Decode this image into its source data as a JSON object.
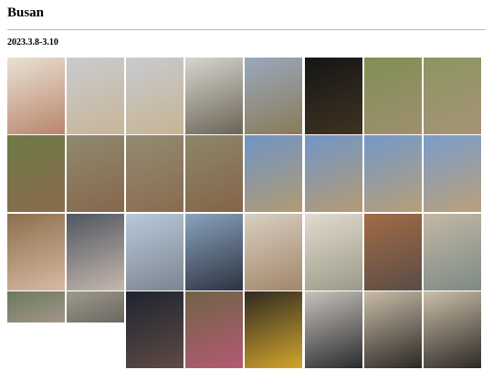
{
  "page": {
    "title": "Busan",
    "date_range": "2023.3.8-3.10"
  },
  "photos": [
    {
      "label": "breakfast-plate",
      "c1": "#e9e2d6",
      "c2": "#b9856a"
    },
    {
      "label": "beach-person",
      "c1": "#c9ccd0",
      "c2": "#c8b497"
    },
    {
      "label": "beach-person-2",
      "c1": "#c7cbd0",
      "c2": "#c7b393"
    },
    {
      "label": "stone-monument",
      "c1": "#d6d6d0",
      "c2": "#6b6454"
    },
    {
      "label": "hill-pavilion",
      "c1": "#9aa9bd",
      "c2": "#8a7a58"
    },
    {
      "label": "night-shrine",
      "c1": "#151515",
      "c2": "#3f3320"
    },
    {
      "label": "bamboo-woman",
      "c1": "#7f8f53",
      "c2": "#a08f70"
    },
    {
      "label": "forest-woman",
      "c1": "#8d9560",
      "c2": "#a69477"
    },
    {
      "label": "tree-woman",
      "c1": "#6d7a46",
      "c2": "#8b6b4c"
    },
    {
      "label": "bare-forest",
      "c1": "#8f8a6f",
      "c2": "#86674c"
    },
    {
      "label": "bare-forest-2",
      "c1": "#928c72",
      "c2": "#8a6b4f"
    },
    {
      "label": "bare-forest-3",
      "c1": "#8d876b",
      "c2": "#846448"
    },
    {
      "label": "village-field",
      "c1": "#6f95c6",
      "c2": "#b29a72"
    },
    {
      "label": "village-field-2",
      "c1": "#7096c8",
      "c2": "#b59b73"
    },
    {
      "label": "village-field-3",
      "c1": "#7399cb",
      "c2": "#b79e76"
    },
    {
      "label": "village-field-4",
      "c1": "#7a9dcb",
      "c2": "#b9a07a"
    },
    {
      "label": "hillside-selfie",
      "c1": "#8c6f4d",
      "c2": "#d8b9a3"
    },
    {
      "label": "couple-masks",
      "c1": "#4f5661",
      "c2": "#c6b7ad"
    },
    {
      "label": "station-building",
      "c1": "#b9c9db",
      "c2": "#7c8590"
    },
    {
      "label": "station-selfie",
      "c1": "#8aa3bd",
      "c2": "#2c3340"
    },
    {
      "label": "pancake-dish",
      "c1": "#d8cfc2",
      "c2": "#a2866a"
    },
    {
      "label": "side-dishes",
      "c1": "#e2dbd0",
      "c2": "#9b9a86"
    },
    {
      "label": "restaurant-man",
      "c1": "#a26c45",
      "c2": "#5a4c46"
    },
    {
      "label": "restaurant-table",
      "c1": "#c2b8a6",
      "c2": "#7e8a84"
    },
    {
      "label": "alley-couple",
      "c1": "#6a7a5c",
      "c2": "#a3958a"
    },
    {
      "label": "mirror-selfie",
      "c1": "#9c9a8c",
      "c2": "#6c6660"
    },
    {
      "label": "couple-portrait",
      "c1": "#1f2430",
      "c2": "#5e4a44"
    },
    {
      "label": "flower-garden",
      "c1": "#6f6346",
      "c2": "#b45a72"
    },
    {
      "label": "dinner-food",
      "c1": "#2f2a22",
      "c2": "#d2a52c"
    },
    {
      "label": "couple-close",
      "c1": "#c7c2bc",
      "c2": "#2b2b2e"
    },
    {
      "label": "elevator-couple",
      "c1": "#c9bda8",
      "c2": "#2b2724"
    },
    {
      "label": "elevator-couple-2",
      "c1": "#cbbfa9",
      "c2": "#2d2926"
    }
  ]
}
